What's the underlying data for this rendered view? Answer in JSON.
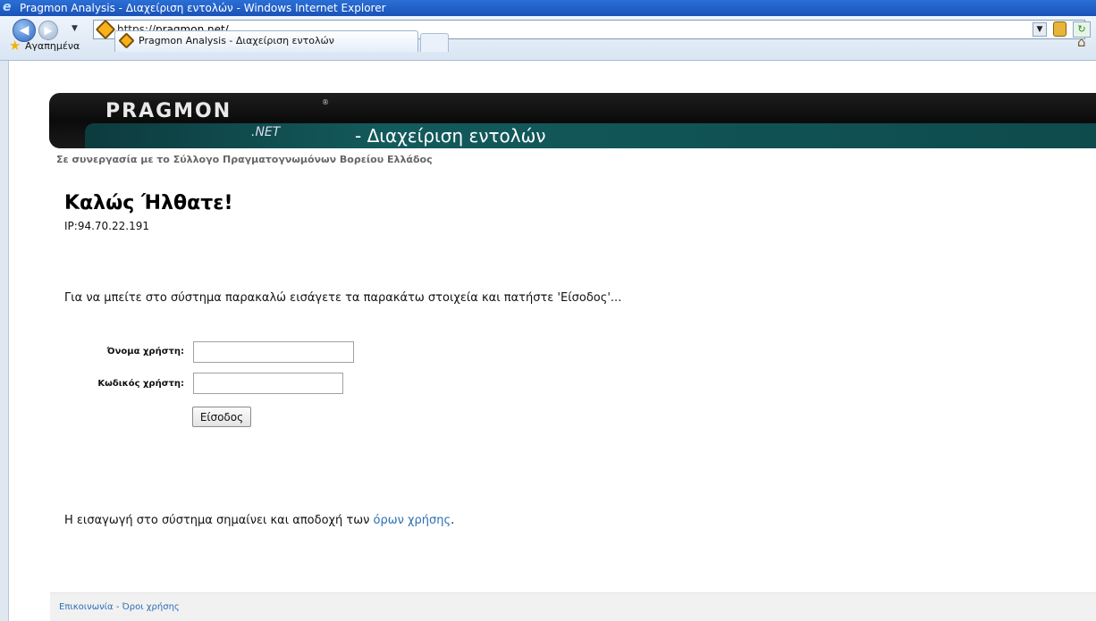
{
  "window": {
    "title": "Pragmon Analysis - Διαχείριση εντολών - Windows Internet Explorer",
    "icon": "ie-icon"
  },
  "browser": {
    "address_proto": "https://",
    "address_host": "pragmon.net/",
    "favorites_label": "Αγαπημένα",
    "tab_title": "Pragmon Analysis - Διαχείριση εντολών"
  },
  "header": {
    "logo_text": "PRAGMON",
    "logo_suffix": ".NET",
    "logo_reg": "®",
    "title": "- Διαχείριση εντολών"
  },
  "page": {
    "subtitle": "Σε συνεργασία με το Σύλλογο Πραγματογνωμόνων Βορείου Ελλάδος",
    "welcome": "Καλώς Ήλθατε!",
    "ip": "IP:94.70.22.191",
    "instructions": "Για να μπείτε στο σύστημα παρακαλώ εισάγετε τα παρακάτω στοιχεία και πατήστε 'Είσοδος'...",
    "terms_prefix": "Η εισαγωγή στο σύστημα σημαίνει και αποδοχή των ",
    "terms_link": "όρων χρήσης",
    "terms_suffix": "."
  },
  "login_form": {
    "username_label": "Όνομα χρήστη:",
    "username_value": "",
    "password_label": "Κωδικός χρήστη:",
    "password_value": "",
    "submit_label": "Είσοδος"
  },
  "footer": {
    "contact_link": "Επικοινωνία",
    "separator": " - ",
    "terms_link": "Όροι χρήσης"
  }
}
